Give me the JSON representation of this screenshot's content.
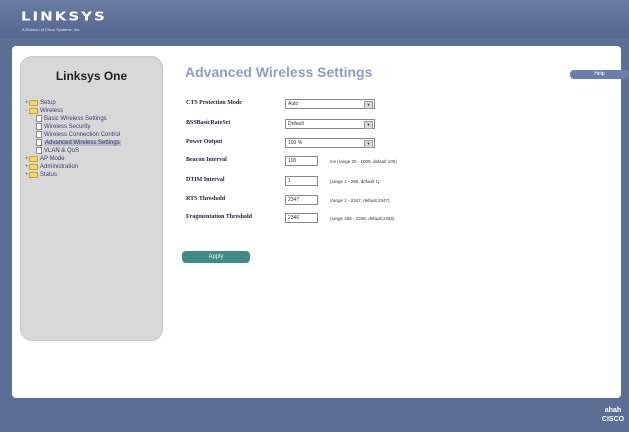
{
  "header": {
    "brand": "LINKSYS",
    "brand_sub": "A Division of Cisco Systems, Inc."
  },
  "sidebar": {
    "title": "Linksys One",
    "items": [
      {
        "label": "Setup",
        "type": "folder",
        "level": 0,
        "expander": "+"
      },
      {
        "label": "Wireless",
        "type": "folder",
        "level": 0,
        "expander": "-"
      },
      {
        "label": "Basic Wireless Settings",
        "type": "page",
        "level": 1
      },
      {
        "label": "Wireless Security",
        "type": "page",
        "level": 1
      },
      {
        "label": "Wireless Connection Control",
        "type": "page",
        "level": 1
      },
      {
        "label": "Advanced Wireless Settings",
        "type": "page",
        "level": 1,
        "selected": true
      },
      {
        "label": "VLAN & QoS",
        "type": "page",
        "level": 1
      },
      {
        "label": "AP Mode",
        "type": "folder",
        "level": 0,
        "expander": "+"
      },
      {
        "label": "Administration",
        "type": "folder",
        "level": 0,
        "expander": "+"
      },
      {
        "label": "Status",
        "type": "folder",
        "level": 0,
        "expander": "+"
      }
    ]
  },
  "main": {
    "title": "Advanced Wireless Settings",
    "help_label": "Help",
    "fields": [
      {
        "label": "CTS Protection Mode",
        "kind": "select",
        "value": "Auto",
        "hint": ""
      },
      {
        "label": "BSSBasicRateSet",
        "kind": "select",
        "value": "Default",
        "hint": ""
      },
      {
        "label": "Power Output",
        "kind": "select",
        "value": "100 %",
        "hint": ""
      },
      {
        "label": "Beacon Interval",
        "kind": "text",
        "value": "100",
        "hint": "ms (range 20 - 1000, default 100)"
      },
      {
        "label": "DTIM Interval",
        "kind": "text",
        "value": "1",
        "hint": "(range 1 - 255, default 1)"
      },
      {
        "label": "RTS Threshold",
        "kind": "text",
        "value": "2347",
        "hint": "(range 1 - 2347, default 2347)"
      },
      {
        "label": "Fragmentation Threshold",
        "kind": "text",
        "value": "2346",
        "hint": "(range 256 - 2346, default 2346)"
      }
    ],
    "apply_label": "Apply"
  },
  "footer": {
    "brand_top": "ahah",
    "brand_bottom": "CISCO"
  },
  "colors": {
    "background": "#5d6e94",
    "title": "#8d9dc3",
    "apply": "#3f8c86",
    "help": "#6b7fae"
  }
}
